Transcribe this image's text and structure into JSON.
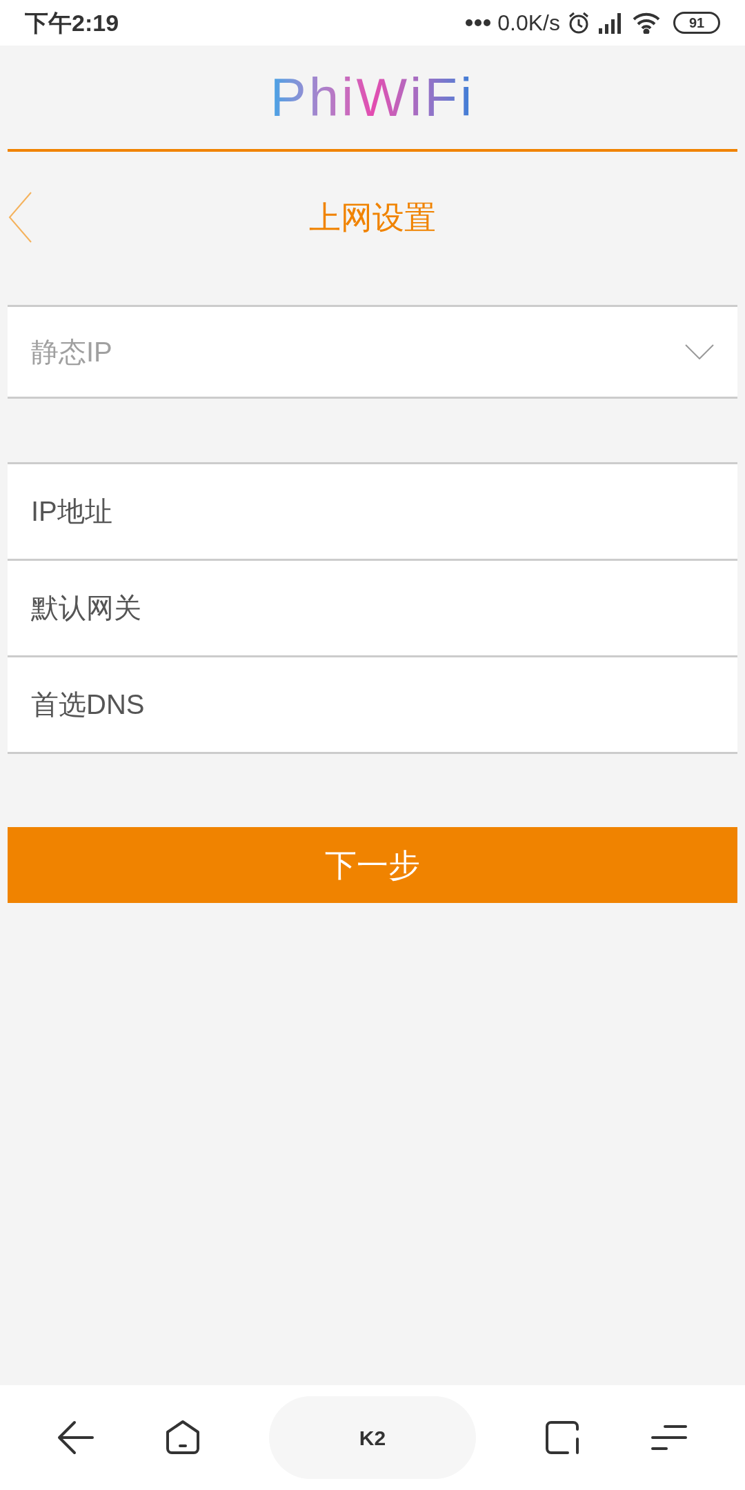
{
  "status_bar": {
    "time": "下午2:19",
    "net_speed": "0.0K/s",
    "battery": "91"
  },
  "logo": "PhiWiFi",
  "header": {
    "title": "上网设置"
  },
  "mode_select": {
    "value": "静态IP"
  },
  "fields": [
    {
      "placeholder": "IP地址"
    },
    {
      "placeholder": "默认网关"
    },
    {
      "placeholder": "首选DNS"
    }
  ],
  "next_button": "下一步",
  "nav_bar": {
    "center_label": "K2"
  }
}
